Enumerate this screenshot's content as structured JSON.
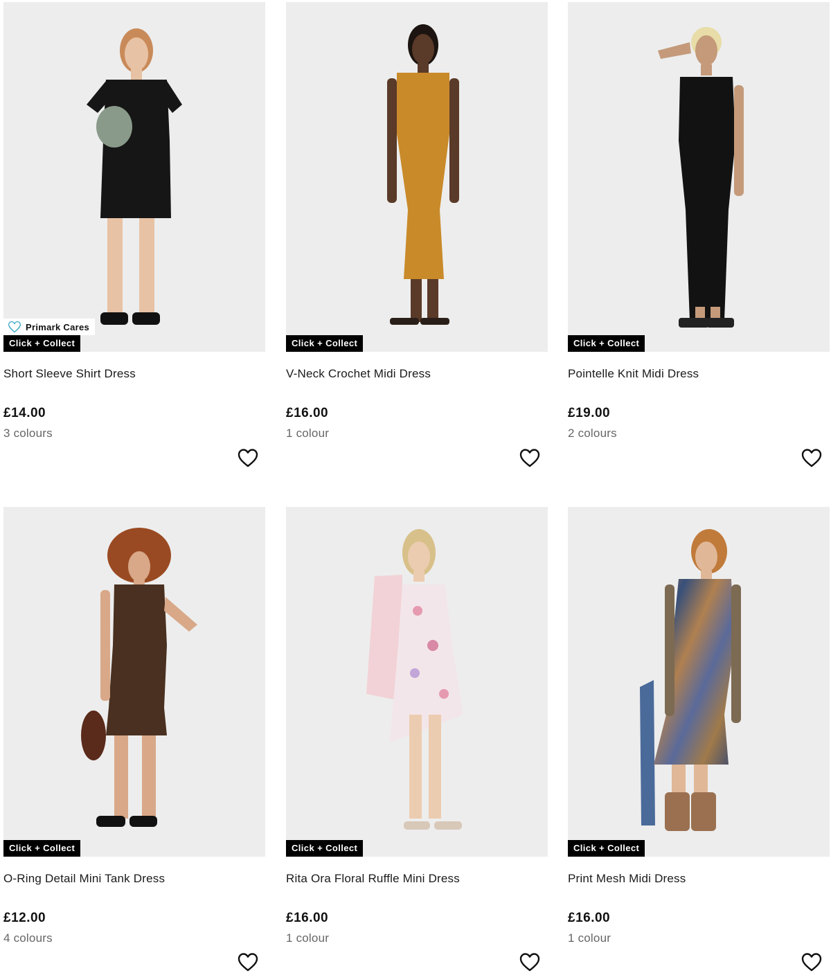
{
  "products": [
    {
      "name": "Short Sleeve Shirt Dress",
      "price": "£14.00",
      "colours": "3 colours",
      "badge": "Click + Collect",
      "cares_badge": "Primark Cares",
      "garment_color": "#161616"
    },
    {
      "name": "V-Neck Crochet Midi Dress",
      "price": "£16.00",
      "colours": "1 colour",
      "badge": "Click + Collect",
      "garment_color": "#c98a2a"
    },
    {
      "name": "Pointelle Knit Midi Dress",
      "price": "£19.00",
      "colours": "2 colours",
      "badge": "Click + Collect",
      "garment_color": "#121212"
    },
    {
      "name": "O-Ring Detail Mini Tank Dress",
      "price": "£12.00",
      "colours": "4 colours",
      "badge": "Click + Collect",
      "garment_color": "#4a3020"
    },
    {
      "name": "Rita Ora Floral Ruffle Mini Dress",
      "price": "£16.00",
      "colours": "1 colour",
      "badge": "Click + Collect",
      "garment_color": "#f3e6ea"
    },
    {
      "name": "Print Mesh Midi Dress",
      "price": "£16.00",
      "colours": "1 colour",
      "badge": "Click + Collect",
      "garment_color": "#7c6a52"
    }
  ],
  "icons": {
    "wishlist": "heart-outline-icon",
    "cares": "heart-icon"
  },
  "colors": {
    "background": "#ffffff",
    "image_bg": "#ededed",
    "badge_bg": "#000000",
    "badge_text": "#ffffff",
    "cares_heart": "#3aa6c9",
    "secondary_text": "#666666"
  }
}
